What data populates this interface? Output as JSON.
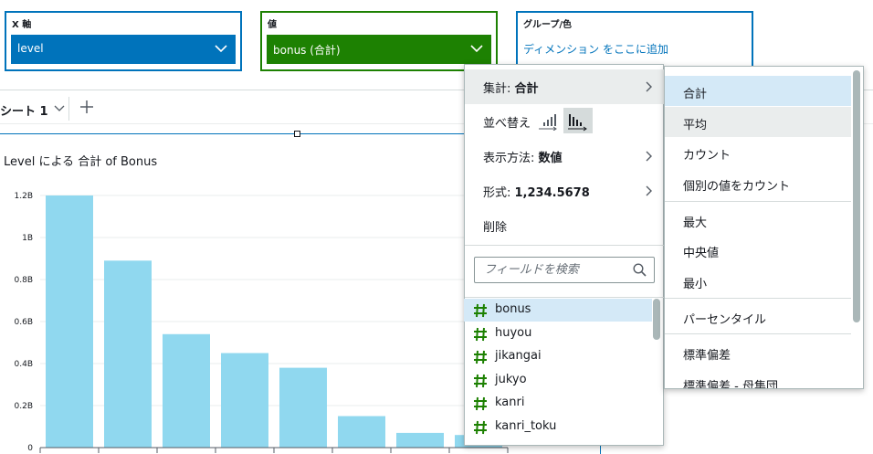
{
  "wells": {
    "x_axis": {
      "title": "X 軸",
      "field": "level"
    },
    "value": {
      "title": "値",
      "field": "bonus (合計)"
    },
    "group": {
      "title": "グループ/色",
      "placeholder": "ディメンション をここに追加"
    }
  },
  "sheets": {
    "active": "シート 1"
  },
  "visual": {
    "title": "Level による 合計 of Bonus"
  },
  "chart_data": {
    "type": "bar",
    "title": "Level による 合計 of Bonus",
    "xlabel": "",
    "ylabel": "",
    "ylim": [
      0,
      1.2
    ],
    "y_ticks": [
      "0",
      "0.2B",
      "0.4B",
      "0.6B",
      "0.8B",
      "1B",
      "1.2B"
    ],
    "values": [
      1.2,
      0.89,
      0.54,
      0.45,
      0.38,
      0.15,
      0.07,
      0.06
    ],
    "bar_color": "#90d8ef",
    "grid": true
  },
  "menu": {
    "aggregate_label": "集計: ",
    "aggregate_value": "合計",
    "sort_label": "並べ替え",
    "display_label": "表示方法: ",
    "display_value": "数値",
    "format_label": "形式: ",
    "format_value": "1,234.5678",
    "delete_label": "削除",
    "search_placeholder": "フィールドを検索",
    "fields": [
      "bonus",
      "huyou",
      "jikangai",
      "jukyo",
      "kanri",
      "kanri_toku"
    ]
  },
  "submenu": {
    "items": [
      "合計",
      "平均",
      "カウント",
      "個別の値をカウント",
      "最大",
      "中央値",
      "最小",
      "パーセンタイル",
      "標準偏差",
      "標準偏差 - 母集団"
    ]
  },
  "colors": {
    "accent_blue": "#0073bb",
    "accent_green": "#1d8102",
    "field_hash": "#1d8102"
  }
}
